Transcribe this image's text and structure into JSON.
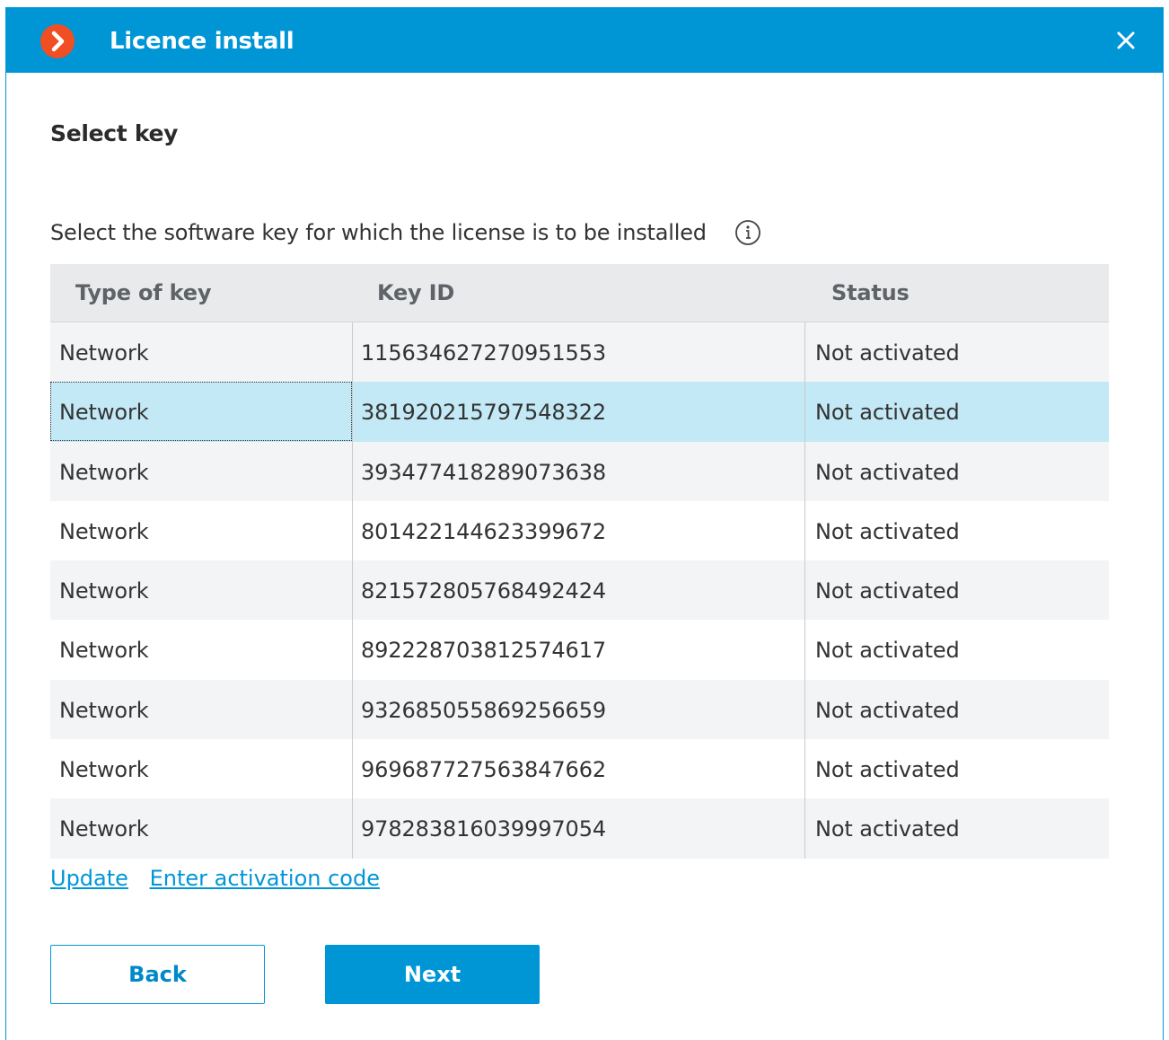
{
  "window": {
    "title": "Licence install",
    "accent_color": "#0096d6",
    "logo_color": "#f04e23"
  },
  "page": {
    "section_title": "Select key",
    "instruction": "Select the software key for which the license is to be installed"
  },
  "table": {
    "headers": [
      "Type of key",
      "Key ID",
      "Status"
    ],
    "rows": [
      {
        "type": "Network",
        "key_id": "115634627270951553",
        "status": "Not activated"
      },
      {
        "type": "Network",
        "key_id": "381920215797548322",
        "status": "Not activated",
        "selected": true
      },
      {
        "type": "Network",
        "key_id": "393477418289073638",
        "status": "Not activated"
      },
      {
        "type": "Network",
        "key_id": "801422144623399672",
        "status": "Not activated"
      },
      {
        "type": "Network",
        "key_id": "821572805768492424",
        "status": "Not activated"
      },
      {
        "type": "Network",
        "key_id": "892228703812574617",
        "status": "Not activated"
      },
      {
        "type": "Network",
        "key_id": "932685055869256659",
        "status": "Not activated"
      },
      {
        "type": "Network",
        "key_id": "969687727563847662",
        "status": "Not activated"
      },
      {
        "type": "Network",
        "key_id": "978283816039997054",
        "status": "Not activated"
      }
    ]
  },
  "links": {
    "update": "Update",
    "enter_code": "Enter activation code"
  },
  "buttons": {
    "back": "Back",
    "next": "Next"
  },
  "icons": {
    "logo": "chevron-right-logo-icon",
    "close": "close-icon",
    "info": "info-icon"
  }
}
